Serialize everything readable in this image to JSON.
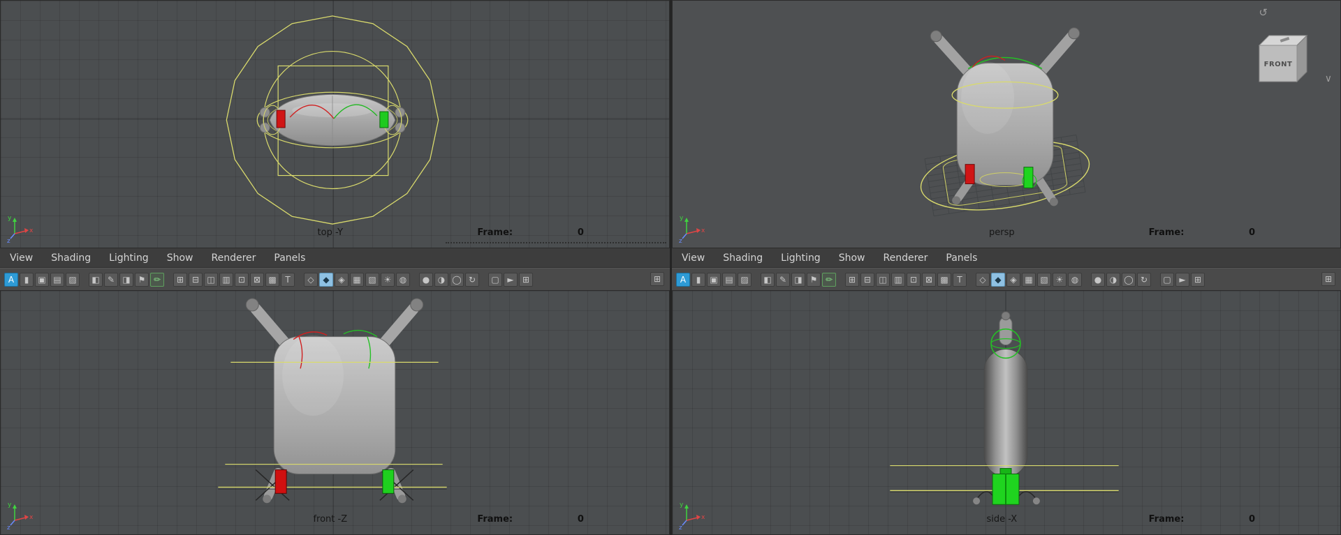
{
  "panel_menu": {
    "items": [
      {
        "name": "menu-view",
        "label": "View"
      },
      {
        "name": "menu-shading",
        "label": "Shading"
      },
      {
        "name": "menu-lighting",
        "label": "Lighting"
      },
      {
        "name": "menu-show",
        "label": "Show"
      },
      {
        "name": "menu-renderer",
        "label": "Renderer"
      },
      {
        "name": "menu-panels",
        "label": "Panels"
      }
    ]
  },
  "toolbar": {
    "end_glyph": "⊞",
    "icons": [
      {
        "name": "select-camera-icon",
        "glyph": "A",
        "cls": "ic-blue"
      },
      {
        "name": "lock-camera-icon",
        "glyph": "▮"
      },
      {
        "name": "camera-attributes-icon",
        "glyph": "▣"
      },
      {
        "name": "bookmarks-icon",
        "glyph": "▤"
      },
      {
        "name": "image-plane-icon",
        "glyph": "▨"
      },
      {
        "name": "separator",
        "glyph": "",
        "cls": "sep",
        "inter": "false"
      },
      {
        "name": "two-d-pan-zoom-icon",
        "glyph": "◧"
      },
      {
        "name": "grease-pencil-icon",
        "glyph": "✎"
      },
      {
        "name": "camera-view-icon",
        "glyph": "◨"
      },
      {
        "name": "snap-flag-icon",
        "glyph": "⚑"
      },
      {
        "name": "edit-pencil-icon",
        "glyph": "✏",
        "cls": "ic-green"
      },
      {
        "name": "separator",
        "glyph": "",
        "cls": "sep",
        "inter": "false"
      },
      {
        "name": "grid-display-icon",
        "glyph": "⊞"
      },
      {
        "name": "film-gate-icon",
        "glyph": "⊟"
      },
      {
        "name": "resolution-gate-icon",
        "glyph": "◫"
      },
      {
        "name": "gate-mask-icon",
        "glyph": "▥"
      },
      {
        "name": "field-chart-icon",
        "glyph": "⊡"
      },
      {
        "name": "safe-action-icon",
        "glyph": "⊠"
      },
      {
        "name": "safe-title-icon",
        "glyph": "▩"
      },
      {
        "name": "heads-up-display-icon",
        "glyph": "T"
      },
      {
        "name": "separator",
        "glyph": "",
        "cls": "sep",
        "inter": "false"
      },
      {
        "name": "wireframe-mode-icon",
        "glyph": "◇"
      },
      {
        "name": "shaded-mode-icon",
        "glyph": "◆",
        "cls": "ic-lite"
      },
      {
        "name": "textured-mode-icon",
        "glyph": "◈"
      },
      {
        "name": "materials-mode-icon",
        "glyph": "▦"
      },
      {
        "name": "checker-mode-icon",
        "glyph": "▧"
      },
      {
        "name": "use-all-lights-icon",
        "glyph": "☀"
      },
      {
        "name": "shadows-icon",
        "glyph": "◍"
      },
      {
        "name": "separator",
        "glyph": "",
        "cls": "sep",
        "inter": "false"
      },
      {
        "name": "occlusion-icon",
        "glyph": "●"
      },
      {
        "name": "motion-blur-icon",
        "glyph": "◑"
      },
      {
        "name": "anti-alias-icon",
        "glyph": "◯"
      },
      {
        "name": "exposure-icon",
        "glyph": "↻"
      },
      {
        "name": "separator",
        "glyph": "",
        "cls": "sep",
        "inter": "false"
      },
      {
        "name": "isolate-select-icon",
        "glyph": "▢"
      },
      {
        "name": "xray-icon",
        "glyph": "►"
      },
      {
        "name": "plugin-icon",
        "glyph": "⊞"
      }
    ]
  },
  "viewports": {
    "top": {
      "label": "top -Y",
      "frame_label": "Frame:",
      "frame_value": "0"
    },
    "persp": {
      "label": "persp",
      "frame_label": "Frame:",
      "frame_value": "0",
      "view_cube_label": "FRONT"
    },
    "front": {
      "label": "front -Z",
      "frame_label": "Frame:",
      "frame_value": "0"
    },
    "side": {
      "label": "side -X",
      "frame_label": "Frame:",
      "frame_value": "0"
    }
  },
  "axis": {
    "x": "x",
    "y": "y",
    "z": "z"
  },
  "colors": {
    "viewport_bg": "#4b4e50",
    "grid_line": "#414446",
    "curve_yellow": "#d9da6c",
    "handle_red": "#d01515",
    "handle_green": "#1fca1f",
    "menu_bg": "#3d3d3d",
    "toolbar_bg": "#4a4a4a",
    "accent_blue": "#2e9bd6",
    "label_text": "#141414"
  }
}
